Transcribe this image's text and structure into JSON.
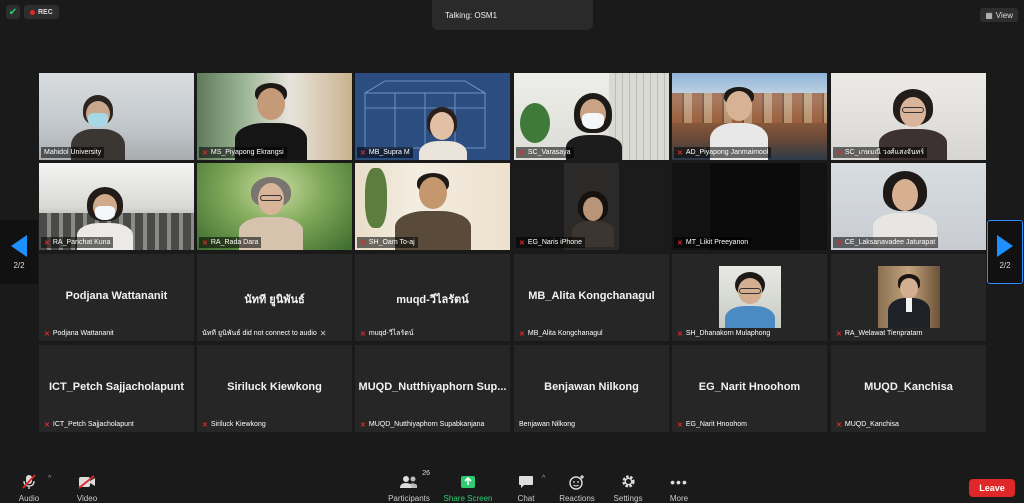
{
  "top": {
    "rec_label": "REC",
    "talking": "Talking: OSM1",
    "view_label": "View"
  },
  "page_indicator": "2/2",
  "video_tiles": [
    {
      "name": "Mahidol University",
      "muted": false
    },
    {
      "name": "MS_Piyapong Ekrangsi",
      "muted": true
    },
    {
      "name": "MB_Supra M",
      "muted": true
    },
    {
      "name": "SC_Varasaya",
      "muted": true
    },
    {
      "name": "AD_Piyapong Janmaimool",
      "muted": true
    },
    {
      "name": "SC_เกษมณี วงศ์แสงจันทร์",
      "muted": true
    },
    {
      "name": "RA_Parichat Kuna",
      "muted": true
    },
    {
      "name": "RA_Rada Dara",
      "muted": true
    },
    {
      "name": "SH_Oam To-aj",
      "muted": true
    },
    {
      "name": "EG_Naris iPhone",
      "muted": true
    },
    {
      "name": "MT_Likit Preeyanon",
      "muted": true
    },
    {
      "name": "CE_Laksanavadee Jaturapat",
      "muted": true
    }
  ],
  "name_tiles": [
    {
      "big": "Podjana Wattananit",
      "label": "Podjana Wattananit",
      "muted": true
    },
    {
      "big": "นัทที ยูนิพันธ์",
      "label": "นัทที ยูนิพันธ์ did not connect to audio",
      "muted": false
    },
    {
      "big": "muqd-วีไลรัตน์",
      "label": "muqd-วีไลรัตน์",
      "muted": true
    },
    {
      "big": "MB_Alita Kongchanagul",
      "label": "MB_Alita Kongchanagul",
      "muted": true
    },
    {
      "big": "",
      "label": "SH_Dhanakorn Mulaphong",
      "muted": true
    },
    {
      "big": "",
      "label": "RA_Welawat Tienpratarn",
      "muted": true
    },
    {
      "big": "ICT_Petch Sajjacholapunt",
      "label": "ICT_Petch Sajjacholapunt",
      "muted": true
    },
    {
      "big": "Siriluck Kiewkong",
      "label": "Siriluck Kiewkong",
      "muted": true
    },
    {
      "big": "MUQD_Nutthiyaphorn Sup...",
      "label": "MUQD_Nutthiyaphorn Supabkanjana",
      "muted": true
    },
    {
      "big": "Benjawan Nilkong",
      "label": "Benjawan Nilkong",
      "muted": false
    },
    {
      "big": "EG_Narit Hnoohom",
      "label": "EG_Narit Hnoohom",
      "muted": true
    },
    {
      "big": "MUQD_Kanchisa",
      "label": "MUQD_Kanchisa",
      "muted": true
    }
  ],
  "toolbar": {
    "audio": "Audio",
    "video": "Video",
    "participants": "Participants",
    "participants_count": "26",
    "share_screen": "Share Screen",
    "chat": "Chat",
    "reactions": "Reactions",
    "settings": "Settings",
    "more": "More",
    "leave": "Leave"
  },
  "colors": {
    "accent": "#1e90ff",
    "share": "#2ecc71",
    "leave": "#e02828",
    "muted_icon": "#e02828"
  }
}
